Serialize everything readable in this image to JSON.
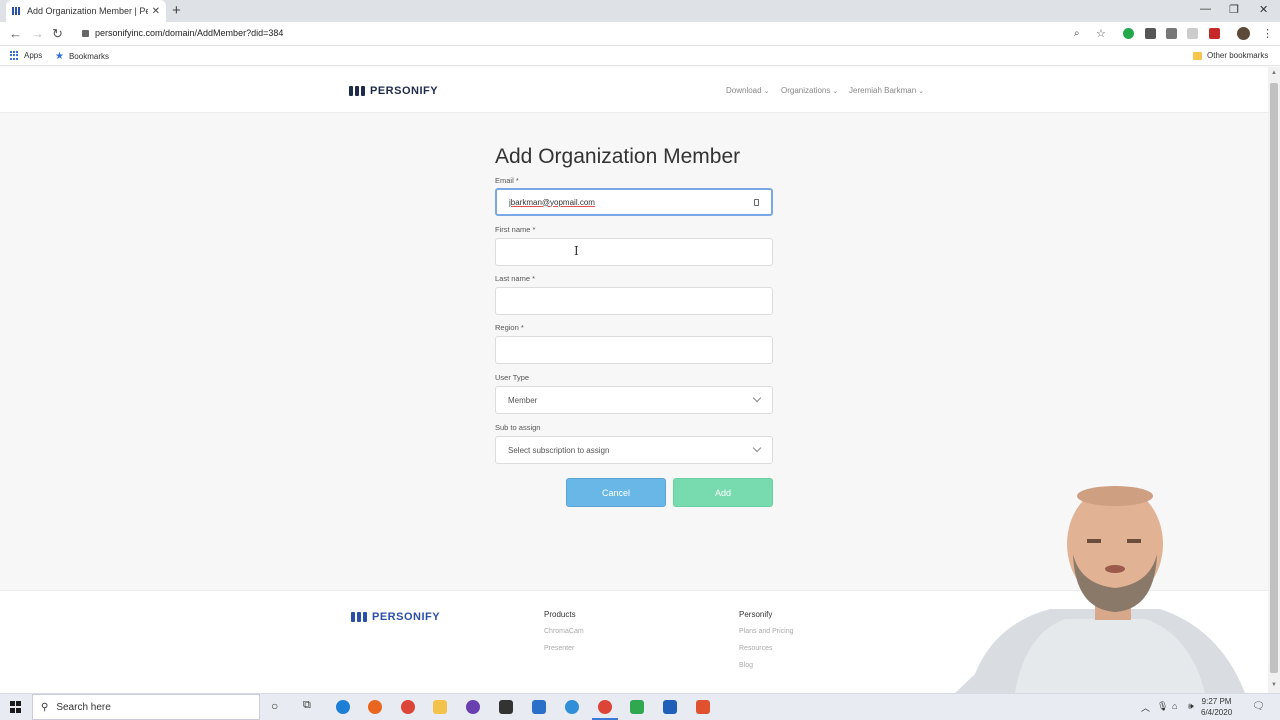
{
  "browser": {
    "tab_title": "Add Organization Member | Pers",
    "tab_close": "✕",
    "new_tab": "+",
    "url": "personifyinc.com/domain/AddMember?did=384",
    "bookmarks": {
      "apps": "Apps",
      "bookmarks": "Bookmarks",
      "other": "Other bookmarks"
    }
  },
  "header": {
    "logo_text": "PERSONIFY",
    "nav": [
      {
        "label": "Download"
      },
      {
        "label": "Organizations"
      },
      {
        "label": "Jeremiah Barkman"
      }
    ]
  },
  "form": {
    "title": "Add Organization Member",
    "email": {
      "label": "Email *",
      "value": "jbarkman@yopmail.com"
    },
    "first_name": {
      "label": "First name *",
      "value": ""
    },
    "last_name": {
      "label": "Last name *",
      "value": ""
    },
    "region": {
      "label": "Region *",
      "value": ""
    },
    "user_type": {
      "label": "User Type",
      "selected": "Member"
    },
    "subscription": {
      "label": "Sub to assign",
      "selected": "Select subscription to assign"
    },
    "cancel_label": "Cancel",
    "add_label": "Add"
  },
  "footer": {
    "logo_text": "PERSONIFY",
    "products": {
      "title": "Products",
      "links": [
        "ChromaCam",
        "Presenter"
      ]
    },
    "personify": {
      "title": "Personify",
      "links": [
        "Plans and Pricing",
        "Resources",
        "Blog"
      ]
    }
  },
  "taskbar": {
    "search_placeholder": "Search here",
    "time": "9:27 PM",
    "date": "6/4/2020"
  },
  "colors": {
    "brand": "#2a4fa8",
    "cancel": "#69b7e7",
    "add": "#78dbb0"
  }
}
